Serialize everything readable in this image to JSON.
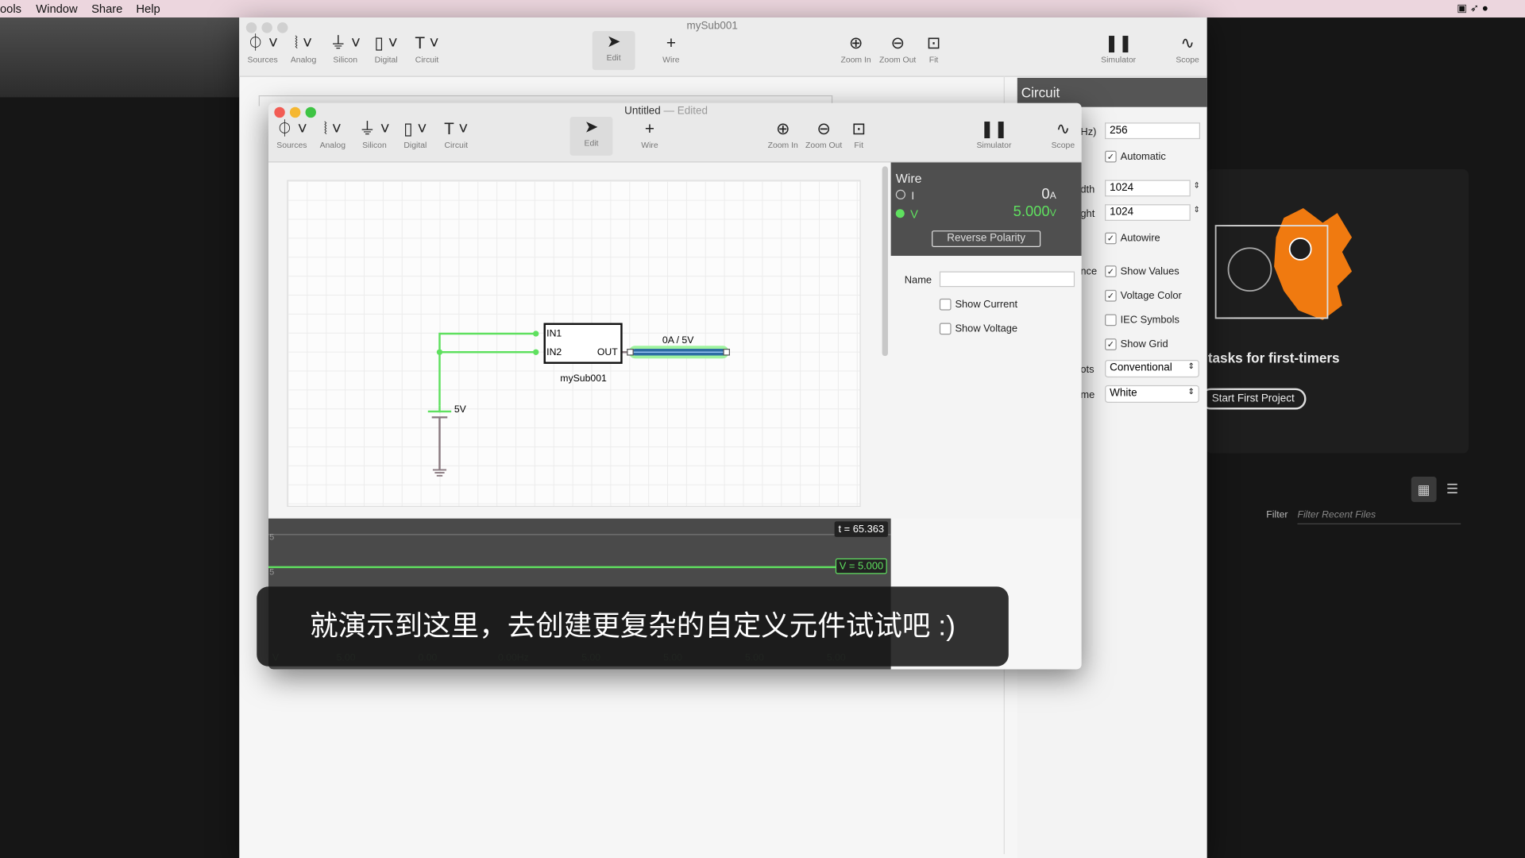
{
  "menubar": {
    "items": [
      "ools",
      "Window",
      "Share",
      "Help"
    ]
  },
  "back_window": {
    "title": "mySub001",
    "toolbar": [
      "Sources",
      "Analog",
      "Silicon",
      "Digital",
      "Circuit",
      "Edit",
      "Wire",
      "Zoom In",
      "Zoom Out",
      "Fit",
      "Simulator",
      "Scope"
    ],
    "text_label_icon": "Text Label"
  },
  "circuit_panel": {
    "title": "Circuit",
    "rate_label": "Hz)",
    "rate_value": "256",
    "automatic": "Automatic",
    "width_label": "dth",
    "width_value": "1024",
    "height_label": "ght",
    "height_value": "1024",
    "autowire": "Autowire",
    "appearance_label": "nce",
    "show_values": "Show Values",
    "voltage_color": "Voltage Color",
    "iec_symbols": "IEC Symbols",
    "show_grid": "Show Grid",
    "plots_label": "ots",
    "plots_value": "Conventional",
    "theme_label": "me",
    "theme_value": "White"
  },
  "welcome": {
    "heading": "tasks for first-timers",
    "start_button": "Start First Project",
    "filter_label": "Filter",
    "filter_placeholder": "Filter Recent Files"
  },
  "front_window": {
    "title": "Untitled",
    "edited": "— Edited",
    "toolbar": [
      "Sources",
      "Analog",
      "Silicon",
      "Digital",
      "Circuit",
      "Edit",
      "Wire",
      "Zoom In",
      "Zoom Out",
      "Fit",
      "Simulator",
      "Scope"
    ]
  },
  "circuit": {
    "component": "mySub001",
    "in1": "IN1",
    "in2": "IN2",
    "out": "OUT",
    "wire_label": "0A / 5V",
    "source_label": "5V"
  },
  "inspector": {
    "title": "Wire",
    "current_label": "I",
    "current_value": "0",
    "current_unit": "A",
    "voltage_label": "V",
    "voltage_value": "5.000",
    "voltage_unit": "V",
    "reverse_button": "Reverse Polarity",
    "name_label": "Name",
    "name_value": "",
    "show_current": "Show Current",
    "show_voltage": "Show Voltage"
  },
  "scope": {
    "time": "t = 65.363",
    "value": "V = 5.000",
    "axis_top": "5",
    "axis_bottom": "5",
    "readouts": [
      "V",
      "5.00",
      "0.00",
      "0.00Hz",
      "5.00",
      "5.00",
      "5.00",
      "5.00"
    ]
  },
  "subtitle": "就演示到这里，去创建更复杂的自定义元件试试吧 :)",
  "colors": {
    "wire_live": "#5fe05f",
    "accent_orange": "#f07a10",
    "selected_wire": "#2e6da4"
  }
}
